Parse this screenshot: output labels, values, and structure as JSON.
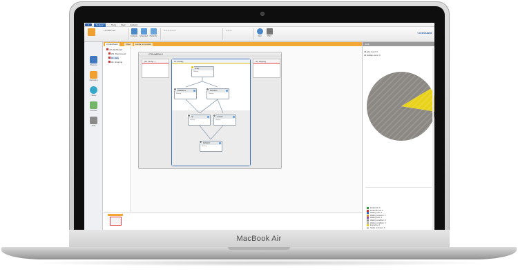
{
  "device": {
    "brand_label": "MacBook Air"
  },
  "app": {
    "title": "",
    "ribbon_tabs": [
      "Netgear",
      "Tools",
      "View",
      "Analysis"
    ],
    "active_tab_index": 0,
    "brand_logo": {
      "prefix": "<",
      "name": "cenGuard",
      "suffix": ""
    },
    "ribbon_buttons": [
      {
        "label": "Compute",
        "icon": "compute-icon",
        "color": "#4a87c9"
      },
      {
        "label": "Scheduled",
        "icon": "calendar-icon",
        "color": "#5c9bd8"
      },
      {
        "label": "Hierarchy",
        "icon": "hierarchy-icon",
        "color": "#6aa2dc"
      },
      {
        "label": "Find",
        "icon": "search-icon",
        "color": "#4a87c9"
      },
      {
        "label": "Print",
        "icon": "print-icon",
        "color": "#777777"
      }
    ],
    "sidebar": [
      {
        "label": "Overview",
        "icon": "overview-icon",
        "color": "#f0a030"
      },
      {
        "label": "Planning",
        "icon": "planning-icon",
        "color": "#3f78c0"
      },
      {
        "label": "Monitoring",
        "icon": "monitoring-icon",
        "color": "#f0a030"
      },
      {
        "label": "History",
        "icon": "history-icon",
        "color": "#35a7c9"
      },
      {
        "label": "Forecast",
        "icon": "forecast-icon",
        "color": "#74b56a"
      },
      {
        "label": "Tools",
        "icon": "tools-icon",
        "color": "#8a8a8a"
      }
    ],
    "tree": [
      {
        "label": "ctrl-dashboard",
        "level": 0
      },
      {
        "label": "[01: fileprocess]",
        "level": 1
      },
      {
        "label": "01: daily",
        "level": 1
      },
      {
        "label": "02: shipping",
        "level": 1
      }
    ],
    "doc_tabs": [
      {
        "label": "ctrl-dashboard",
        "active": true
      },
      {
        "label": "Object",
        "active": false
      },
      {
        "label": "sample computation",
        "active": false
      }
    ],
    "diagram": {
      "title": "CTRLWEEKLY",
      "lanes": [
        {
          "label": "[01: file Ap...]"
        },
        {
          "label": "01: dbdaily"
        },
        {
          "label": "02: shipping"
        }
      ],
      "nodes": [
        {
          "title": "ready",
          "sub": "Waiting",
          "status": "yellow"
        },
        {
          "title": "Databases",
          "sub": "Waiting",
          "status": "gray"
        },
        {
          "title": "Filewatch",
          "sub": "Waiting",
          "status": "gray"
        },
        {
          "title": "ftp",
          "sub": "Waiting",
          "status": "gray"
        },
        {
          "title": "network",
          "sub": "Waiting",
          "status": "gray"
        },
        {
          "title": "fileMonitr",
          "sub": "Waiting",
          "status": "gray"
        }
      ]
    },
    "right_pane": {
      "header": "Jobs",
      "stats": [
        {
          "label": "All jobs count:",
          "value": "9"
        },
        {
          "label": "All holiday count:",
          "value": "0"
        }
      ],
      "legend": [
        {
          "label": "Ended Ok",
          "value": "0",
          "color": "#2c9c3a"
        },
        {
          "label": "Ended Not ok",
          "value": "0",
          "color": "#d12f2f"
        },
        {
          "label": "Waiting user",
          "value": "0",
          "color": "#3467c4"
        },
        {
          "label": "Waiting resource",
          "value": "0",
          "color": "#e08b26"
        },
        {
          "label": "Waiting host",
          "value": "0",
          "color": "#8a4fb3"
        },
        {
          "label": "Waiting condition",
          "value": "8",
          "color": "#8b8783"
        },
        {
          "label": "Waiting condition",
          "value": "0",
          "color": "#bdb6ad"
        },
        {
          "label": "Executing",
          "value": "1",
          "color": "#e8d21a"
        },
        {
          "label": "Status unknown",
          "value": "0",
          "color": "#c9c9c9"
        }
      ]
    },
    "statusbar": {
      "left": "Total Fewer Folders: 9",
      "right": "Total Jobs: 1/9"
    }
  },
  "chart_data": {
    "type": "pie",
    "categories": [
      "Waiting condition",
      "Executing"
    ],
    "values": [
      8,
      1
    ],
    "colors": [
      "#8b8783",
      "#e8d21a"
    ],
    "title": ""
  }
}
